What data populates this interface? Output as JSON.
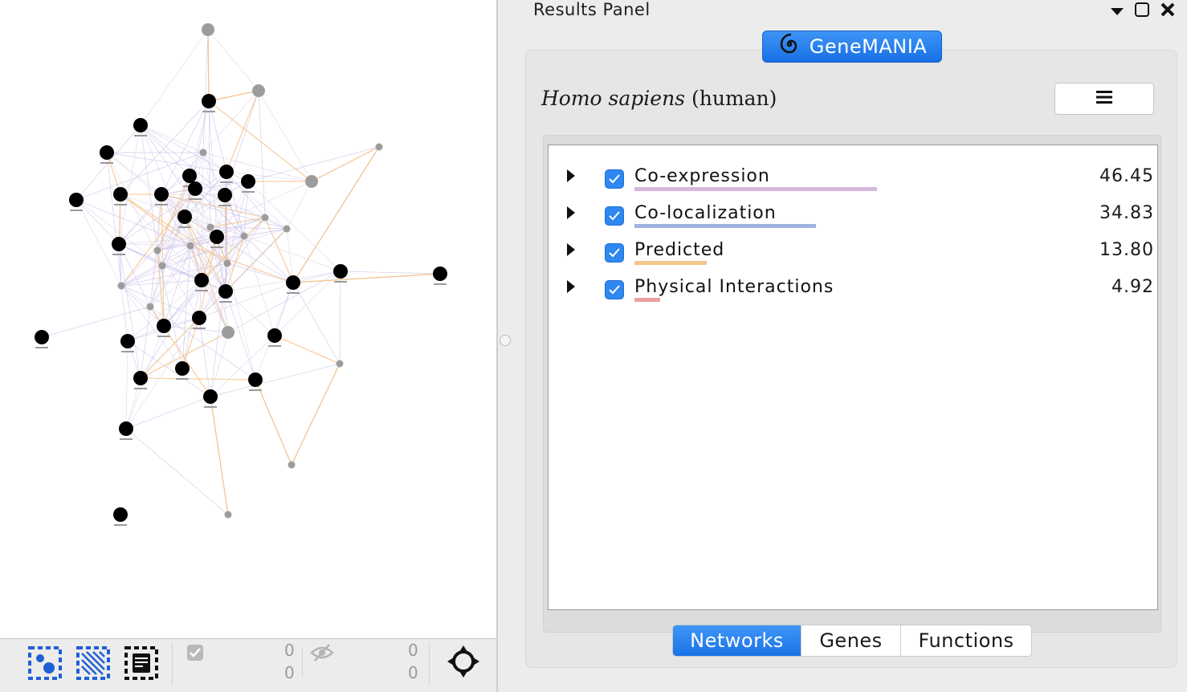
{
  "results_panel": {
    "title": "Results Panel",
    "controls": [
      "dropdown-arrow-icon",
      "float-window-icon",
      "close-icon"
    ]
  },
  "app": {
    "name": "GeneMANIA",
    "badge_color": "#2580ee"
  },
  "organism": {
    "scientific": "Homo sapiens",
    "common": "(human)"
  },
  "networks": [
    {
      "name": "Co-expression",
      "value": "46.45",
      "weight": 46.45,
      "color": "#d7b7dd",
      "checked": true
    },
    {
      "name": "Co-localization",
      "value": "34.83",
      "weight": 34.83,
      "color": "#a0b3dd",
      "checked": true
    },
    {
      "name": "Predicted",
      "value": "13.80",
      "weight": 13.8,
      "color": "#f5c58d",
      "checked": true
    },
    {
      "name": "Physical Interactions",
      "value": "4.92",
      "weight": 4.92,
      "color": "#eaa0a2",
      "checked": true
    }
  ],
  "tabs": [
    {
      "label": "Networks",
      "active": true
    },
    {
      "label": "Genes",
      "active": false
    },
    {
      "label": "Functions",
      "active": false
    }
  ],
  "toolbar": {
    "selected_nodes": "0",
    "selected_edges": "0",
    "hidden_nodes": "0",
    "hidden_edges": "0",
    "icons": [
      "select-nodes-icon",
      "select-edges-icon",
      "select-annotations-icon",
      "checkbox-icon",
      "hide-eye-icon",
      "fit-view-crosshair-icon"
    ]
  },
  "accent_color": "#2f87f0"
}
